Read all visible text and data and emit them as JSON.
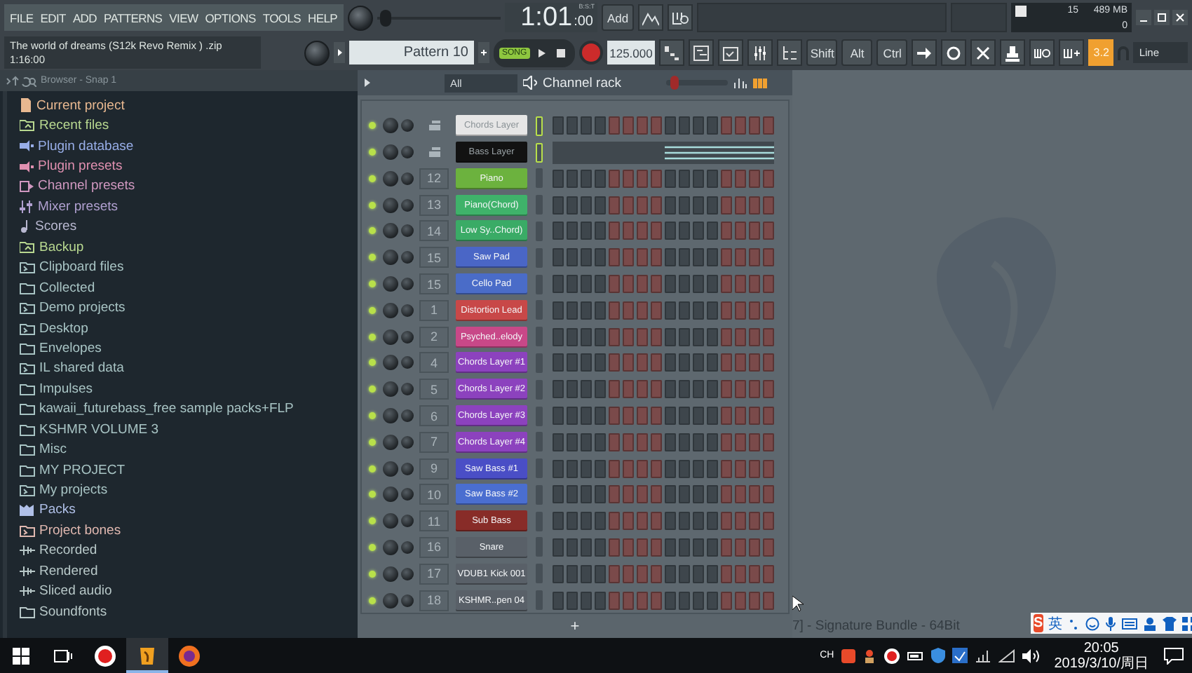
{
  "menu": [
    "FILE",
    "EDIT",
    "ADD",
    "PATTERNS",
    "VIEW",
    "OPTIONS",
    "TOOLS",
    "HELP"
  ],
  "project": {
    "title": "The world of dreams (S12k Revo Remix ) .zip",
    "time": "1:16:00"
  },
  "clock": {
    "main": "1:01",
    "sub": ":00",
    "label": "B:S:T"
  },
  "master_pitch": {
    "level": 0.03
  },
  "swing": {
    "level": 0.08
  },
  "add_button": "Add",
  "cpu": {
    "polyphony": "15",
    "memory": "489 MB",
    "value": "0"
  },
  "pattern": "Pattern 10",
  "mode": {
    "label": "SONG",
    "on": true
  },
  "tempo": "125.000",
  "modifiers": [
    "Shift",
    "Alt",
    "Ctrl"
  ],
  "snap": {
    "label": "3.2",
    "on": true
  },
  "snap_mode": "Line",
  "browser": {
    "title": "Browser - Snap 1",
    "items": [
      {
        "label": "Current project",
        "kind": "project",
        "color": "#e8b890"
      },
      {
        "label": "Recent files",
        "kind": "recent",
        "color": "#b8d890"
      },
      {
        "label": "Plugin database",
        "kind": "plugin",
        "color": "#98aee8"
      },
      {
        "label": "Plugin presets",
        "kind": "plugin",
        "color": "#e090b0"
      },
      {
        "label": "Channel presets",
        "kind": "channel",
        "color": "#d098c0"
      },
      {
        "label": "Mixer presets",
        "kind": "mixer",
        "color": "#b0a0d0"
      },
      {
        "label": "Scores",
        "kind": "score",
        "color": "#b8b8d0"
      },
      {
        "label": "Backup",
        "kind": "recent",
        "color": "#b8d890"
      },
      {
        "label": "Clipboard files",
        "kind": "folder_link",
        "color": "#a8c4c4"
      },
      {
        "label": "Collected",
        "kind": "folder",
        "color": "#a8c4c4"
      },
      {
        "label": "Demo projects",
        "kind": "folder_link",
        "color": "#a8c4c4"
      },
      {
        "label": "Desktop",
        "kind": "folder_link",
        "color": "#a8c4c4"
      },
      {
        "label": "Envelopes",
        "kind": "folder",
        "color": "#a8c4c4"
      },
      {
        "label": "IL shared data",
        "kind": "folder_link",
        "color": "#a8c4c4"
      },
      {
        "label": "Impulses",
        "kind": "folder",
        "color": "#a8c4c4"
      },
      {
        "label": "kawaii_futurebass_free sample packs+FLP",
        "kind": "folder",
        "color": "#a8c4c4"
      },
      {
        "label": "KSHMR VOLUME 3",
        "kind": "folder",
        "color": "#a8c4c4"
      },
      {
        "label": "Misc",
        "kind": "folder",
        "color": "#a8c4c4"
      },
      {
        "label": "MY PROJECT",
        "kind": "folder",
        "color": "#a8c4c4"
      },
      {
        "label": "My projects",
        "kind": "folder_link",
        "color": "#a8c4c4"
      },
      {
        "label": "Packs",
        "kind": "packs",
        "color": "#b0c0e8"
      },
      {
        "label": "Project bones",
        "kind": "folder_link",
        "color": "#e0b8b0"
      },
      {
        "label": "Recorded",
        "kind": "audio",
        "color": "#b8c8c8"
      },
      {
        "label": "Rendered",
        "kind": "audio",
        "color": "#b8c8c8"
      },
      {
        "label": "Sliced audio",
        "kind": "audio",
        "color": "#b8c8c8"
      },
      {
        "label": "Soundfonts",
        "kind": "folder",
        "color": "#b8c8c8"
      }
    ]
  },
  "channel_rack": {
    "filter": "All",
    "title": "Channel rack",
    "add": "+",
    "channels": [
      {
        "name": "Chords Layer",
        "color": "#e6e6e6",
        "kind": "steps",
        "selected": true,
        "enabled": true
      },
      {
        "name": "Bass Layer",
        "color": "#121212",
        "kind": "pianoroll",
        "selected": true,
        "enabled": true
      },
      {
        "number": "12",
        "name": "Piano",
        "color": "#6cb23e",
        "kind": "steps",
        "selected": false,
        "enabled": true
      },
      {
        "number": "13",
        "name": "Piano(Chord)",
        "color": "#3fb26a",
        "kind": "steps",
        "selected": false,
        "enabled": true
      },
      {
        "number": "14",
        "name": "Low Sy..Chord)",
        "color": "#3aab66",
        "kind": "steps",
        "selected": false,
        "enabled": true
      },
      {
        "number": "15",
        "name": "Saw Pad",
        "color": "#4a66c6",
        "kind": "steps",
        "selected": false,
        "enabled": true
      },
      {
        "number": "15",
        "name": "Cello Pad",
        "color": "#4a6cc8",
        "kind": "steps",
        "selected": false,
        "enabled": true
      },
      {
        "number": "1",
        "name": "Distortion Lead",
        "color": "#c84848",
        "kind": "steps",
        "selected": false,
        "enabled": true
      },
      {
        "number": "2",
        "name": "Psyched..elody",
        "color": "#c84888",
        "kind": "steps",
        "selected": false,
        "enabled": true
      },
      {
        "number": "4",
        "name": "Chords Layer #1",
        "color": "#8c42be",
        "kind": "steps",
        "selected": false,
        "enabled": true
      },
      {
        "number": "5",
        "name": "Chords Layer #2",
        "color": "#8c42be",
        "kind": "steps",
        "selected": false,
        "enabled": true
      },
      {
        "number": "6",
        "name": "Chords Layer #3",
        "color": "#8c42be",
        "kind": "steps",
        "selected": false,
        "enabled": true
      },
      {
        "number": "7",
        "name": "Chords Layer #4",
        "color": "#8c42be",
        "kind": "steps",
        "selected": false,
        "enabled": true
      },
      {
        "number": "9",
        "name": "Saw Bass #1",
        "color": "#4a4ec6",
        "kind": "steps",
        "selected": false,
        "enabled": true
      },
      {
        "number": "10",
        "name": "Saw Bass #2",
        "color": "#4a6ed0",
        "kind": "steps",
        "selected": false,
        "enabled": true
      },
      {
        "number": "11",
        "name": "Sub Bass",
        "color": "#882c28",
        "kind": "steps",
        "selected": false,
        "enabled": true
      },
      {
        "number": "16",
        "name": "Snare",
        "color": "#596068",
        "kind": "steps",
        "selected": false,
        "enabled": true
      },
      {
        "number": "17",
        "name": "VDUB1 Kick 001",
        "color": "#596068",
        "kind": "steps",
        "selected": false,
        "enabled": true
      },
      {
        "number": "18",
        "name": "KSHMR..pen 04",
        "color": "#596068",
        "kind": "steps",
        "selected": false,
        "enabled": true
      }
    ]
  },
  "background_title": "7] - Signature Bundle - 64Bit",
  "ime": {
    "logo": "S",
    "mode": "英"
  },
  "taskbar": {
    "apps": [
      {
        "kind": "recorder",
        "selected": false
      },
      {
        "kind": "fl",
        "selected": true
      },
      {
        "kind": "browser",
        "selected": false
      }
    ],
    "language": "CH",
    "time": "20:05",
    "date": "2019/3/10/周日"
  }
}
